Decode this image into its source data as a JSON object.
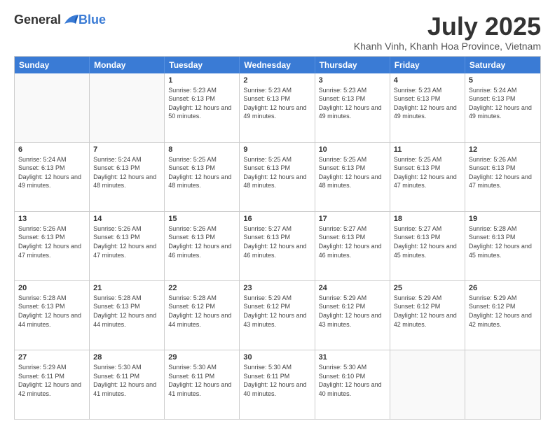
{
  "logo": {
    "general": "General",
    "blue": "Blue"
  },
  "title": "July 2025",
  "subtitle": "Khanh Vinh, Khanh Hoa Province, Vietnam",
  "header_days": [
    "Sunday",
    "Monday",
    "Tuesday",
    "Wednesday",
    "Thursday",
    "Friday",
    "Saturday"
  ],
  "weeks": [
    [
      {
        "day": "",
        "info": "",
        "empty": true
      },
      {
        "day": "",
        "info": "",
        "empty": true
      },
      {
        "day": "1",
        "info": "Sunrise: 5:23 AM\nSunset: 6:13 PM\nDaylight: 12 hours and 50 minutes."
      },
      {
        "day": "2",
        "info": "Sunrise: 5:23 AM\nSunset: 6:13 PM\nDaylight: 12 hours and 49 minutes."
      },
      {
        "day": "3",
        "info": "Sunrise: 5:23 AM\nSunset: 6:13 PM\nDaylight: 12 hours and 49 minutes."
      },
      {
        "day": "4",
        "info": "Sunrise: 5:23 AM\nSunset: 6:13 PM\nDaylight: 12 hours and 49 minutes."
      },
      {
        "day": "5",
        "info": "Sunrise: 5:24 AM\nSunset: 6:13 PM\nDaylight: 12 hours and 49 minutes."
      }
    ],
    [
      {
        "day": "6",
        "info": "Sunrise: 5:24 AM\nSunset: 6:13 PM\nDaylight: 12 hours and 49 minutes."
      },
      {
        "day": "7",
        "info": "Sunrise: 5:24 AM\nSunset: 6:13 PM\nDaylight: 12 hours and 48 minutes."
      },
      {
        "day": "8",
        "info": "Sunrise: 5:25 AM\nSunset: 6:13 PM\nDaylight: 12 hours and 48 minutes."
      },
      {
        "day": "9",
        "info": "Sunrise: 5:25 AM\nSunset: 6:13 PM\nDaylight: 12 hours and 48 minutes."
      },
      {
        "day": "10",
        "info": "Sunrise: 5:25 AM\nSunset: 6:13 PM\nDaylight: 12 hours and 48 minutes."
      },
      {
        "day": "11",
        "info": "Sunrise: 5:25 AM\nSunset: 6:13 PM\nDaylight: 12 hours and 47 minutes."
      },
      {
        "day": "12",
        "info": "Sunrise: 5:26 AM\nSunset: 6:13 PM\nDaylight: 12 hours and 47 minutes."
      }
    ],
    [
      {
        "day": "13",
        "info": "Sunrise: 5:26 AM\nSunset: 6:13 PM\nDaylight: 12 hours and 47 minutes."
      },
      {
        "day": "14",
        "info": "Sunrise: 5:26 AM\nSunset: 6:13 PM\nDaylight: 12 hours and 47 minutes."
      },
      {
        "day": "15",
        "info": "Sunrise: 5:26 AM\nSunset: 6:13 PM\nDaylight: 12 hours and 46 minutes."
      },
      {
        "day": "16",
        "info": "Sunrise: 5:27 AM\nSunset: 6:13 PM\nDaylight: 12 hours and 46 minutes."
      },
      {
        "day": "17",
        "info": "Sunrise: 5:27 AM\nSunset: 6:13 PM\nDaylight: 12 hours and 46 minutes."
      },
      {
        "day": "18",
        "info": "Sunrise: 5:27 AM\nSunset: 6:13 PM\nDaylight: 12 hours and 45 minutes."
      },
      {
        "day": "19",
        "info": "Sunrise: 5:28 AM\nSunset: 6:13 PM\nDaylight: 12 hours and 45 minutes."
      }
    ],
    [
      {
        "day": "20",
        "info": "Sunrise: 5:28 AM\nSunset: 6:13 PM\nDaylight: 12 hours and 44 minutes."
      },
      {
        "day": "21",
        "info": "Sunrise: 5:28 AM\nSunset: 6:13 PM\nDaylight: 12 hours and 44 minutes."
      },
      {
        "day": "22",
        "info": "Sunrise: 5:28 AM\nSunset: 6:12 PM\nDaylight: 12 hours and 44 minutes."
      },
      {
        "day": "23",
        "info": "Sunrise: 5:29 AM\nSunset: 6:12 PM\nDaylight: 12 hours and 43 minutes."
      },
      {
        "day": "24",
        "info": "Sunrise: 5:29 AM\nSunset: 6:12 PM\nDaylight: 12 hours and 43 minutes."
      },
      {
        "day": "25",
        "info": "Sunrise: 5:29 AM\nSunset: 6:12 PM\nDaylight: 12 hours and 42 minutes."
      },
      {
        "day": "26",
        "info": "Sunrise: 5:29 AM\nSunset: 6:12 PM\nDaylight: 12 hours and 42 minutes."
      }
    ],
    [
      {
        "day": "27",
        "info": "Sunrise: 5:29 AM\nSunset: 6:11 PM\nDaylight: 12 hours and 42 minutes."
      },
      {
        "day": "28",
        "info": "Sunrise: 5:30 AM\nSunset: 6:11 PM\nDaylight: 12 hours and 41 minutes."
      },
      {
        "day": "29",
        "info": "Sunrise: 5:30 AM\nSunset: 6:11 PM\nDaylight: 12 hours and 41 minutes."
      },
      {
        "day": "30",
        "info": "Sunrise: 5:30 AM\nSunset: 6:11 PM\nDaylight: 12 hours and 40 minutes."
      },
      {
        "day": "31",
        "info": "Sunrise: 5:30 AM\nSunset: 6:10 PM\nDaylight: 12 hours and 40 minutes."
      },
      {
        "day": "",
        "info": "",
        "empty": true
      },
      {
        "day": "",
        "info": "",
        "empty": true
      }
    ]
  ]
}
